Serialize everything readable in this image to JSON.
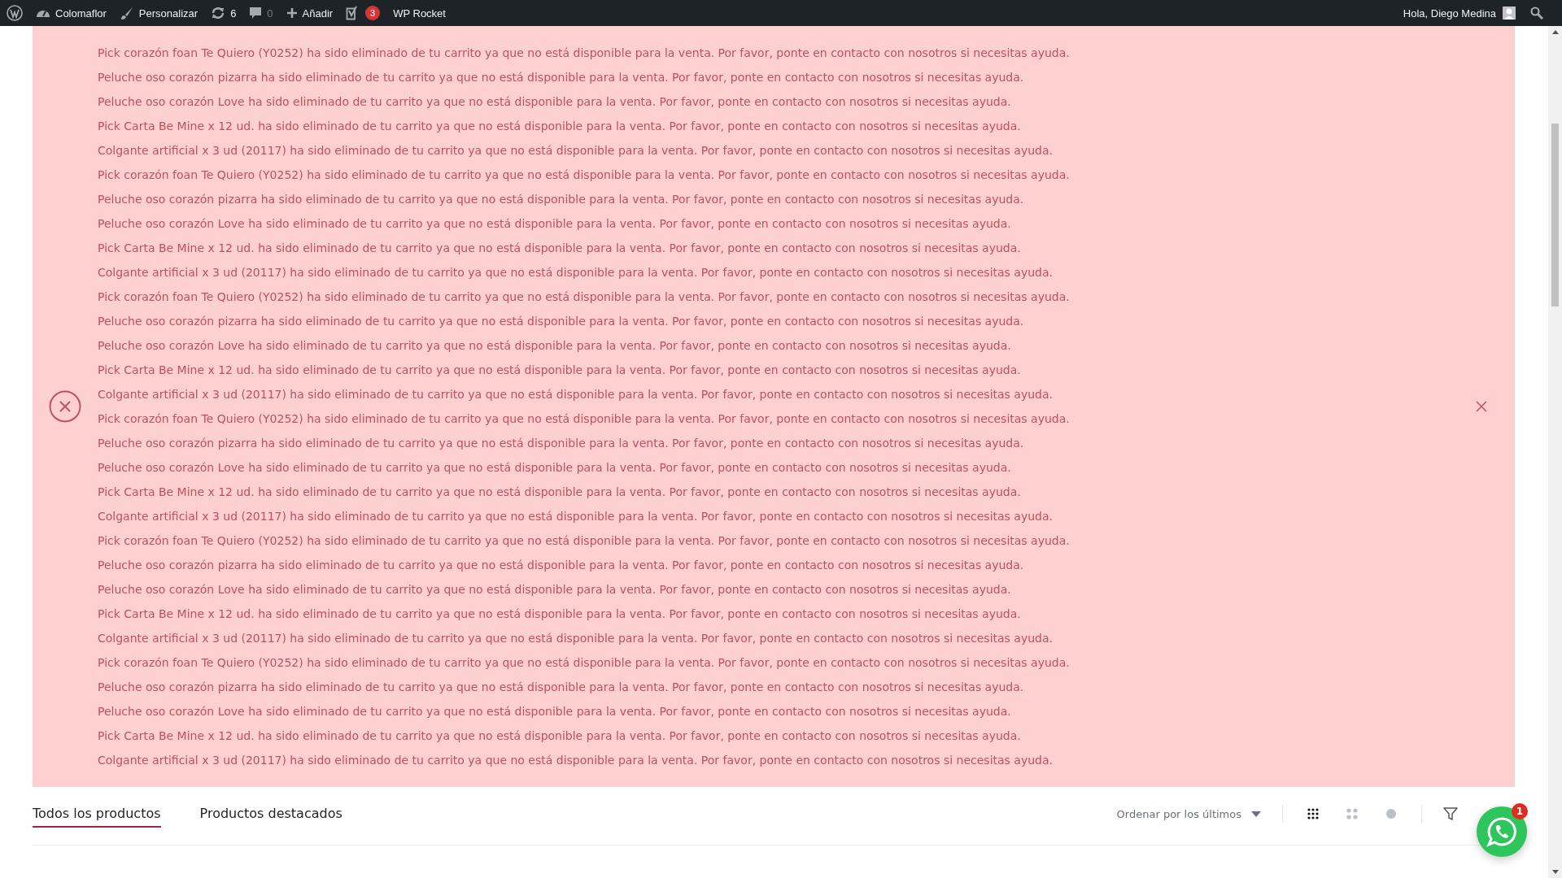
{
  "admin_bar": {
    "items": [
      {
        "kind": "logo"
      },
      {
        "kind": "site",
        "label": "Colomaflor"
      },
      {
        "kind": "customize",
        "label": "Personalizar"
      },
      {
        "kind": "updates",
        "label": "6"
      },
      {
        "kind": "comments",
        "label": "0",
        "disabled": true
      },
      {
        "kind": "new",
        "label": "Añadir"
      },
      {
        "kind": "seo",
        "badge": "3"
      },
      {
        "kind": "plain",
        "label": "WP Rocket"
      }
    ],
    "greeting": "Hola, Diego Medina"
  },
  "notice": {
    "messages": [
      "Pick corazón foan Te Quiero (Y0252) ha sido eliminado de tu carrito ya que no está disponible para la venta. Por favor, ponte en contacto con nosotros si necesitas ayuda.",
      "Peluche oso corazón pizarra ha sido eliminado de tu carrito ya que no está disponible para la venta. Por favor, ponte en contacto con nosotros si necesitas ayuda.",
      "Peluche oso corazón Love ha sido eliminado de tu carrito ya que no está disponible para la venta. Por favor, ponte en contacto con nosotros si necesitas ayuda.",
      "Pick Carta Be Mine x 12 ud. ha sido eliminado de tu carrito ya que no está disponible para la venta. Por favor, ponte en contacto con nosotros si necesitas ayuda.",
      "Colgante artificial x 3 ud (20117) ha sido eliminado de tu carrito ya que no está disponible para la venta. Por favor, ponte en contacto con nosotros si necesitas ayuda.",
      "Pick corazón foan Te Quiero (Y0252) ha sido eliminado de tu carrito ya que no está disponible para la venta. Por favor, ponte en contacto con nosotros si necesitas ayuda.",
      "Peluche oso corazón pizarra ha sido eliminado de tu carrito ya que no está disponible para la venta. Por favor, ponte en contacto con nosotros si necesitas ayuda.",
      "Peluche oso corazón Love ha sido eliminado de tu carrito ya que no está disponible para la venta. Por favor, ponte en contacto con nosotros si necesitas ayuda.",
      "Pick Carta Be Mine x 12 ud. ha sido eliminado de tu carrito ya que no está disponible para la venta. Por favor, ponte en contacto con nosotros si necesitas ayuda.",
      "Colgante artificial x 3 ud (20117) ha sido eliminado de tu carrito ya que no está disponible para la venta. Por favor, ponte en contacto con nosotros si necesitas ayuda.",
      "Pick corazón foan Te Quiero (Y0252) ha sido eliminado de tu carrito ya que no está disponible para la venta. Por favor, ponte en contacto con nosotros si necesitas ayuda.",
      "Peluche oso corazón pizarra ha sido eliminado de tu carrito ya que no está disponible para la venta. Por favor, ponte en contacto con nosotros si necesitas ayuda.",
      "Peluche oso corazón Love ha sido eliminado de tu carrito ya que no está disponible para la venta. Por favor, ponte en contacto con nosotros si necesitas ayuda.",
      "Pick Carta Be Mine x 12 ud. ha sido eliminado de tu carrito ya que no está disponible para la venta. Por favor, ponte en contacto con nosotros si necesitas ayuda.",
      "Colgante artificial x 3 ud (20117) ha sido eliminado de tu carrito ya que no está disponible para la venta. Por favor, ponte en contacto con nosotros si necesitas ayuda.",
      "Pick corazón foan Te Quiero (Y0252) ha sido eliminado de tu carrito ya que no está disponible para la venta. Por favor, ponte en contacto con nosotros si necesitas ayuda.",
      "Peluche oso corazón pizarra ha sido eliminado de tu carrito ya que no está disponible para la venta. Por favor, ponte en contacto con nosotros si necesitas ayuda.",
      "Peluche oso corazón Love ha sido eliminado de tu carrito ya que no está disponible para la venta. Por favor, ponte en contacto con nosotros si necesitas ayuda.",
      "Pick Carta Be Mine x 12 ud. ha sido eliminado de tu carrito ya que no está disponible para la venta. Por favor, ponte en contacto con nosotros si necesitas ayuda.",
      "Colgante artificial x 3 ud (20117) ha sido eliminado de tu carrito ya que no está disponible para la venta. Por favor, ponte en contacto con nosotros si necesitas ayuda.",
      "Pick corazón foan Te Quiero (Y0252) ha sido eliminado de tu carrito ya que no está disponible para la venta. Por favor, ponte en contacto con nosotros si necesitas ayuda.",
      "Peluche oso corazón pizarra ha sido eliminado de tu carrito ya que no está disponible para la venta. Por favor, ponte en contacto con nosotros si necesitas ayuda.",
      "Peluche oso corazón Love ha sido eliminado de tu carrito ya que no está disponible para la venta. Por favor, ponte en contacto con nosotros si necesitas ayuda.",
      "Pick Carta Be Mine x 12 ud. ha sido eliminado de tu carrito ya que no está disponible para la venta. Por favor, ponte en contacto con nosotros si necesitas ayuda.",
      "Colgante artificial x 3 ud (20117) ha sido eliminado de tu carrito ya que no está disponible para la venta. Por favor, ponte en contacto con nosotros si necesitas ayuda.",
      "Pick corazón foan Te Quiero (Y0252) ha sido eliminado de tu carrito ya que no está disponible para la venta. Por favor, ponte en contacto con nosotros si necesitas ayuda.",
      "Peluche oso corazón pizarra ha sido eliminado de tu carrito ya que no está disponible para la venta. Por favor, ponte en contacto con nosotros si necesitas ayuda.",
      "Peluche oso corazón Love ha sido eliminado de tu carrito ya que no está disponible para la venta. Por favor, ponte en contacto con nosotros si necesitas ayuda.",
      "Pick Carta Be Mine x 12 ud. ha sido eliminado de tu carrito ya que no está disponible para la venta. Por favor, ponte en contacto con nosotros si necesitas ayuda.",
      "Colgante artificial x 3 ud (20117) ha sido eliminado de tu carrito ya que no está disponible para la venta. Por favor, ponte en contacto con nosotros si necesitas ayuda."
    ]
  },
  "tabs": [
    {
      "label": "Todos los productos",
      "selected": true
    },
    {
      "label": "Productos destacados",
      "selected": false
    }
  ],
  "sort": {
    "label": "Ordenar por los últimos"
  },
  "views": [
    {
      "kind": "grid-small",
      "selected": true
    },
    {
      "kind": "grid-large",
      "selected": false
    },
    {
      "kind": "single",
      "selected": false
    }
  ],
  "whatsapp": {
    "badge": "1"
  }
}
